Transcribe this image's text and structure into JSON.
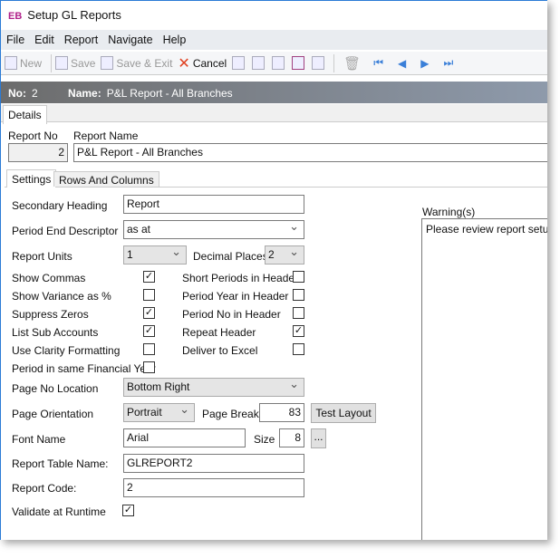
{
  "window": {
    "logo": "EB",
    "title": "Setup GL Reports"
  },
  "menu": [
    "File",
    "Edit",
    "Report",
    "Navigate",
    "Help"
  ],
  "toolbar": {
    "new": "New",
    "save": "Save",
    "save_exit": "Save & Exit",
    "cancel": "Cancel"
  },
  "header": {
    "no_label": "No:",
    "no_value": "2",
    "name_label": "Name:",
    "name_value": "P&L Report - All Branches"
  },
  "tabs": {
    "details": "Details",
    "settings": "Settings",
    "rows_columns": "Rows And Columns"
  },
  "report": {
    "no_label": "Report No",
    "no_value": "2",
    "name_label": "Report Name",
    "name_value": "P&L Report - All Branches"
  },
  "form": {
    "secondary_heading": {
      "label": "Secondary Heading",
      "value": "Report"
    },
    "period_end": {
      "label": "Period End Descriptor",
      "value": "as at"
    },
    "report_units": {
      "label": "Report Units",
      "value": "1"
    },
    "decimal_places": {
      "label": "Decimal Places",
      "value": "2"
    },
    "left_checks": [
      {
        "label": "Show Commas",
        "checked": true
      },
      {
        "label": "Show Variance as %",
        "checked": false
      },
      {
        "label": "Suppress Zeros",
        "checked": true
      },
      {
        "label": "List Sub Accounts",
        "checked": true
      },
      {
        "label": "Use Clarity Formatting",
        "checked": false
      },
      {
        "label": "Period in same Financial Year",
        "checked": false
      }
    ],
    "right_checks": [
      {
        "label": "Short Periods in Header",
        "checked": false
      },
      {
        "label": "Period Year in Header",
        "checked": false
      },
      {
        "label": "Period No in Header",
        "checked": false
      },
      {
        "label": "Repeat Header",
        "checked": true
      },
      {
        "label": "Deliver to Excel",
        "checked": false
      }
    ],
    "page_no_location": {
      "label": "Page No Location",
      "value": "Bottom Right"
    },
    "page_orientation": {
      "label": "Page Orientation",
      "value": "Portrait"
    },
    "page_break": {
      "label": "Page Break",
      "value": "83"
    },
    "test_layout": "Test Layout",
    "font_name": {
      "label": "Font Name",
      "value": "Arial"
    },
    "size": {
      "label": "Size",
      "value": "8"
    },
    "ellipsis": "...",
    "table_name": {
      "label": "Report Table Name:",
      "value": "GLREPORT2"
    },
    "report_code": {
      "label": "Report Code:",
      "value": "2"
    },
    "validate": {
      "label": "Validate at Runtime",
      "checked": true
    }
  },
  "warnings": {
    "label": "Warning(s)",
    "text": "Please review report setup,"
  }
}
